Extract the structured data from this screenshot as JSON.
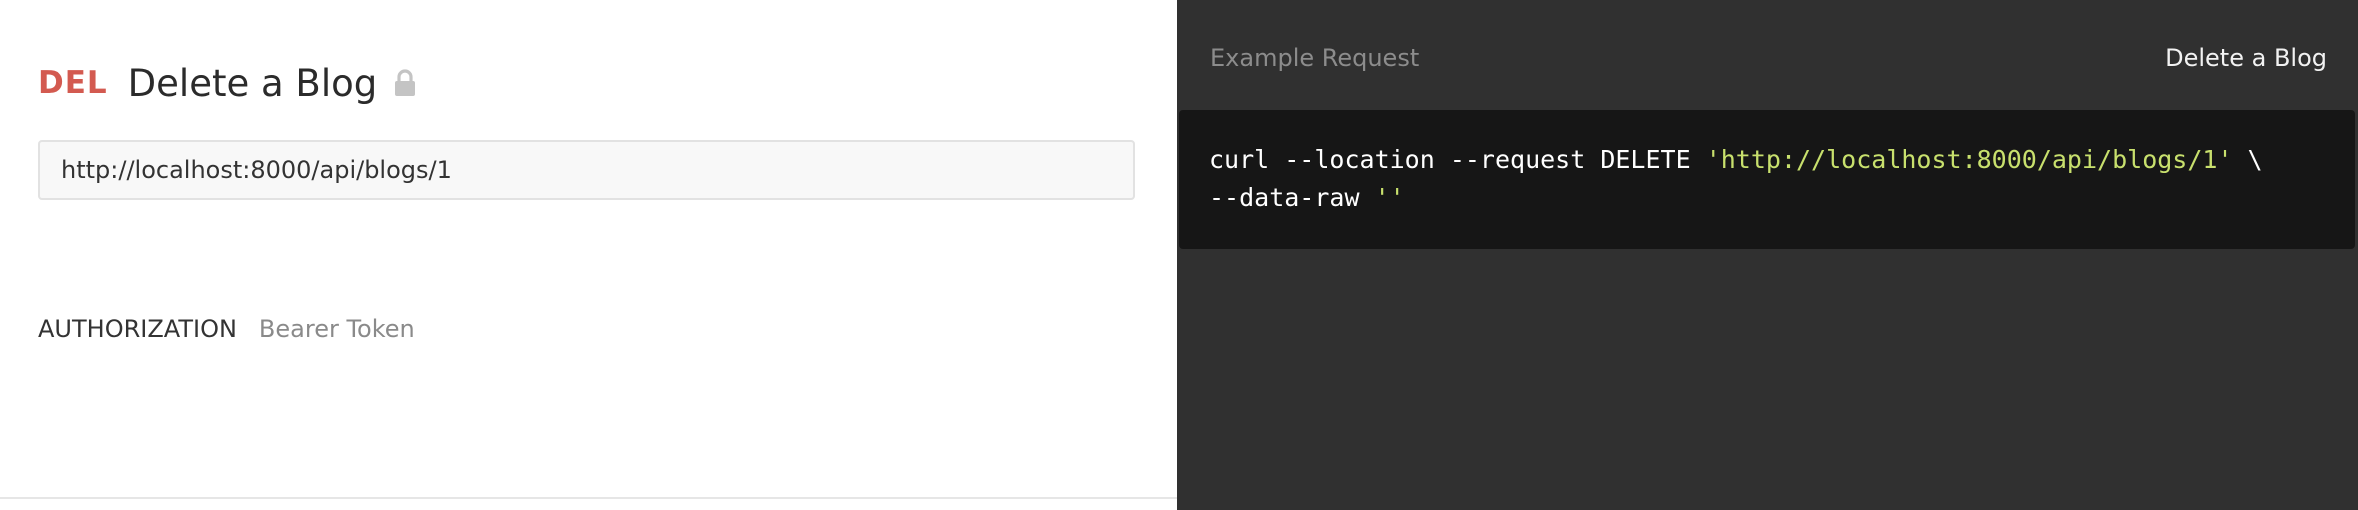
{
  "request": {
    "method": "DEL",
    "title": "Delete a Blog",
    "url": "http://localhost:8000/api/blogs/1",
    "lock_icon": "lock-icon",
    "authorization": {
      "label": "AUTHORIZATION",
      "value": "Bearer Token"
    }
  },
  "example": {
    "label": "Example Request",
    "selected": "Delete a Blog",
    "code": {
      "line1_cmd": "curl --location --request DELETE ",
      "line1_url": "'http://localhost:8000/api/blogs/1'",
      "line1_tail": " \\",
      "line2_cmd": "--data-raw ",
      "line2_str": "''"
    }
  },
  "colors": {
    "method": "#d35a50",
    "dark_panel": "#303030",
    "code_bg": "#161616",
    "code_string": "#c8e06d"
  }
}
